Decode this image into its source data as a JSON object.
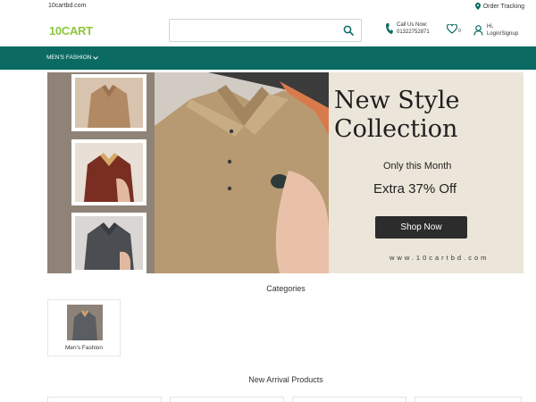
{
  "topbar": {
    "site": "10cartbd.com",
    "order_tracking": "Order Tracking"
  },
  "header": {
    "logo": "10CART",
    "search_placeholder": "",
    "call_label": "Call Us Now:",
    "call_number": "01322752871",
    "wishlist_count": "0",
    "account_greeting": "Hi,",
    "account_action": "Login/Signup"
  },
  "nav": {
    "menu_label": "MEN'S FASHION"
  },
  "banner": {
    "headline_line1": "New Style",
    "headline_line2": "Collection",
    "subline": "Only this Month",
    "offer": "Extra 37% Off",
    "cta": "Shop Now",
    "website": "www.10cartbd.com"
  },
  "categories": {
    "title": "Categories",
    "items": [
      {
        "label": "Men's Fashion"
      }
    ]
  },
  "new_arrivals": {
    "title": "New Arrival Products"
  },
  "colors": {
    "brand": "#0b6b63",
    "logo_green": "#8cc63f",
    "button_dark": "#2c2c2c"
  }
}
